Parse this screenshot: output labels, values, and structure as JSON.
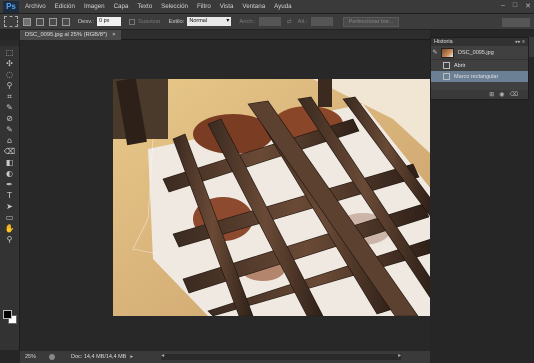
{
  "app": {
    "logo": "Ps"
  },
  "menu": [
    "Archivo",
    "Edición",
    "Imagen",
    "Capa",
    "Texto",
    "Selección",
    "Filtro",
    "Vista",
    "Ventana",
    "Ayuda"
  ],
  "window_controls": [
    "–",
    "□",
    "✕"
  ],
  "options": {
    "feather_label": "Desv.:",
    "feather_value": "0 px",
    "antialias_label": "Suavizar",
    "style_label": "Estilo:",
    "style_value": "Normal",
    "width_label": "Anch.:",
    "height_label": "Alt.:",
    "refine_button": "Perfeccionar bor..."
  },
  "document": {
    "tab_title": "DSC_0095.jpg al 25% (RGB/8*)",
    "tab_close": "×"
  },
  "history": {
    "title": "Historia",
    "menu_glyph": "▸▸ ≡",
    "snapshot_label": "DSC_0095.jpg",
    "items": [
      {
        "label": "Abrir",
        "active": false
      },
      {
        "label": "Marco rectangular",
        "active": true
      }
    ]
  },
  "status": {
    "zoom": "25%",
    "doc_info": "Doc: 14,4 MB/14,4 MB",
    "arrow": "▸"
  },
  "tools": [
    "⬚",
    "✣",
    "◌",
    "⚲",
    "⌗",
    "✎",
    "⊘",
    "✎",
    "⌂",
    "⌫",
    "◧",
    "◐",
    "✒",
    "T",
    "➤",
    "▭",
    "✋",
    "⚲"
  ],
  "colors": {
    "menubar": "#3a3a3a",
    "history_active": "#6b7f95",
    "canvas_bg": "#282828"
  }
}
